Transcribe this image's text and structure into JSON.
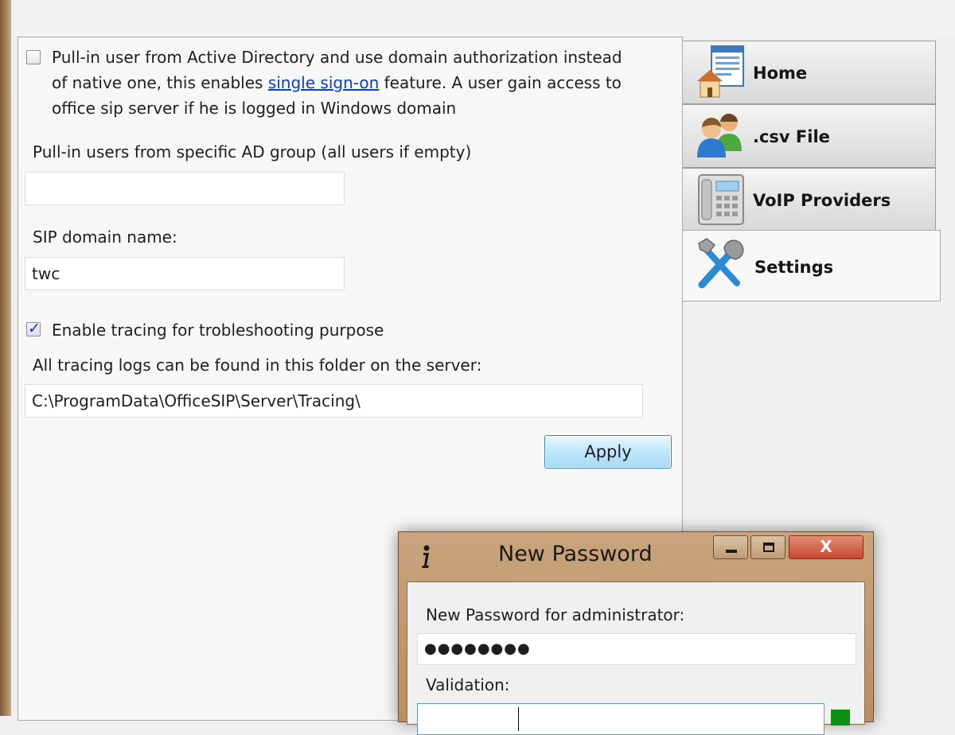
{
  "settings_panel": {
    "ad_checkbox": {
      "checked": false,
      "line1": "Pull-in user from Active Directory and use domain authorization instead",
      "line2_before": "of native one, this enables ",
      "link": "single sign-on",
      "line2_after": " feature. A user gain access to",
      "line3": "office sip server if he is logged in Windows domain"
    },
    "ad_group_label": "Pull-in users from specific AD group (all users if empty)",
    "ad_group_value": "",
    "sip_domain_label": "SIP domain name:",
    "sip_domain_value": "twc",
    "tracing_checkbox": {
      "checked": true,
      "label": "Enable tracing for trobleshooting purpose"
    },
    "tracing_folder_label": "All tracing logs can be found in this folder on the server:",
    "tracing_folder_value": "C:\\ProgramData\\OfficeSIP\\Server\\Tracing\\",
    "apply_label": "Apply"
  },
  "tabs": [
    {
      "label": "Home",
      "icon": "home-icon",
      "active": false
    },
    {
      "label": ".csv File",
      "icon": "users-icon",
      "active": false
    },
    {
      "label": "VoIP Providers",
      "icon": "phone-icon",
      "active": false
    },
    {
      "label": "Settings",
      "icon": "tools-icon",
      "active": true
    }
  ],
  "dialog": {
    "title": "New Password",
    "icon": "info-icon",
    "minimize": "minimize-icon",
    "maximize": "maximize-icon",
    "close_label": "X",
    "password_label": "New Password for administrator:",
    "password_value": "●●●●●●●●",
    "validation_label": "Validation:",
    "validation_value": "",
    "validation_status_color": "#109010"
  },
  "colors": {
    "frame": "#b98e62",
    "link": "#0a3dcb",
    "apply_border": "#3c7fb1",
    "close_button": "#c9472f"
  }
}
